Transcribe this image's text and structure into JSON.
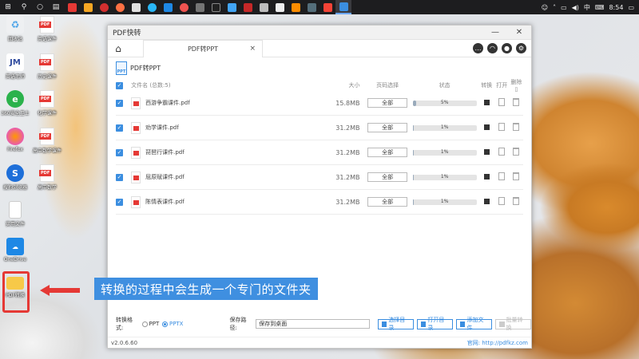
{
  "taskbar": {
    "time": "8:54",
    "ime": "中"
  },
  "desktop": {
    "icons": [
      {
        "label": "回收站"
      },
      {
        "label": "英语课件"
      },
      {
        "label": "英语老师"
      },
      {
        "label": "历史课件"
      },
      {
        "label": "360安全卫士"
      },
      {
        "label": "化学课件"
      },
      {
        "label": "Firefox"
      },
      {
        "label": "高中数学课件"
      },
      {
        "label": "搜狗浏览器"
      },
      {
        "label": "高中数学"
      },
      {
        "label": "实用文件"
      },
      {
        "label": "OneDrive"
      },
      {
        "label": "PDF转换"
      }
    ]
  },
  "window": {
    "title": "PDF快转",
    "tab_label": "PDF转PPT",
    "tab_close": "×",
    "sub_title": "PDF转PPT",
    "sub_icon_text": "PPT"
  },
  "table": {
    "headers": {
      "name": "文件名 (总数:5)",
      "size": "大小",
      "range": "页码选择",
      "status": "状态",
      "convert": "转换",
      "open": "打开",
      "delete": "删除"
    },
    "rows": [
      {
        "name": "西游争霸课件.pdf",
        "size": "15.8MB",
        "range": "全部",
        "progress": 5,
        "progress_label": "5%"
      },
      {
        "name": "劝学课件.pdf",
        "size": "31.2MB",
        "range": "全部",
        "progress": 1,
        "progress_label": "1%"
      },
      {
        "name": "琵琶行课件.pdf",
        "size": "31.2MB",
        "range": "全部",
        "progress": 1,
        "progress_label": "1%"
      },
      {
        "name": "屈原赋课件.pdf",
        "size": "31.2MB",
        "range": "全部",
        "progress": 1,
        "progress_label": "1%"
      },
      {
        "name": "陈情表课件.pdf",
        "size": "31.2MB",
        "range": "全部",
        "progress": 1,
        "progress_label": "1%"
      }
    ]
  },
  "bottom": {
    "format_label": "转换格式:",
    "opt_ppt": "PPT",
    "opt_pptx": "PPTX",
    "selected": "PPTX",
    "path_label": "保存路径:",
    "path_value": "保存到桌面",
    "btn_choose": "选择目录",
    "btn_open": "打开目录",
    "btn_add": "添加文件",
    "btn_batch": "批量转换"
  },
  "footer": {
    "version": "v2.0.6.60",
    "website": "官网: http://pdfkz.com"
  },
  "caption": {
    "text": "转换的过程中会生成一个专门的文件夹"
  },
  "colors": {
    "accent": "#3b8ee0",
    "caption_bg": "#3f8fe0",
    "annotation_red": "#e53935"
  }
}
